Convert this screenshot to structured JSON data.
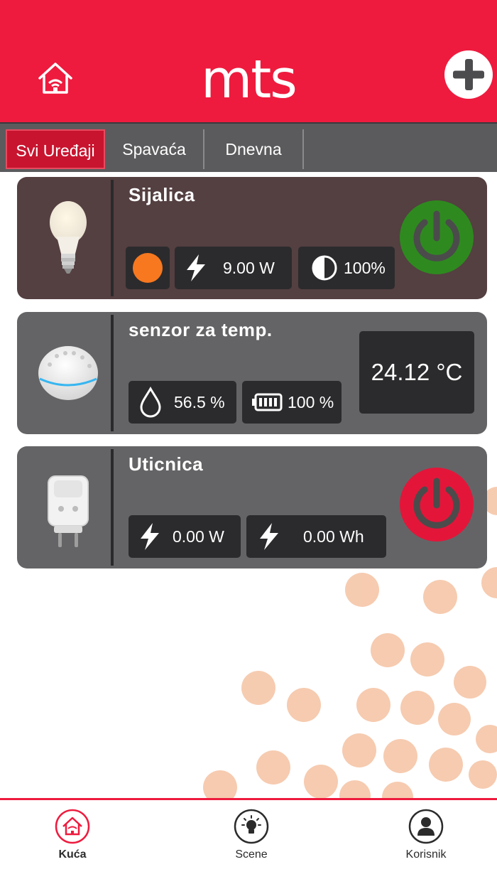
{
  "header": {
    "logo": "mts",
    "home_icon": "home-wifi-icon",
    "add_icon": "plus-icon",
    "color": "#ee1b3e"
  },
  "tabs": [
    {
      "label": "Svi Uređaji",
      "active": true
    },
    {
      "label": "Spavaća",
      "active": false
    },
    {
      "label": "Dnevna",
      "active": false
    }
  ],
  "devices": [
    {
      "title": "Sijalica",
      "image": "light-bulb",
      "color_swatch": "#f7781f",
      "power": "9.00 W",
      "brightness": "100%",
      "state": "on",
      "state_color": "#2e8a1f"
    },
    {
      "title": "senzor za temp.",
      "image": "temperature-sensor",
      "humidity": "56.5 %",
      "battery": "100 %",
      "temperature": "24.12 °C"
    },
    {
      "title": "Uticnica",
      "image": "smart-plug",
      "power": "0.00 W",
      "energy": "0.00 Wh",
      "state": "off",
      "state_color": "#e3163a"
    }
  ],
  "bottom_nav": [
    {
      "label": "Kuća",
      "icon": "home-wifi-icon",
      "active": true
    },
    {
      "label": "Scene",
      "icon": "lightbulb-icon",
      "active": false
    },
    {
      "label": "Korisnik",
      "icon": "user-icon",
      "active": false
    }
  ]
}
